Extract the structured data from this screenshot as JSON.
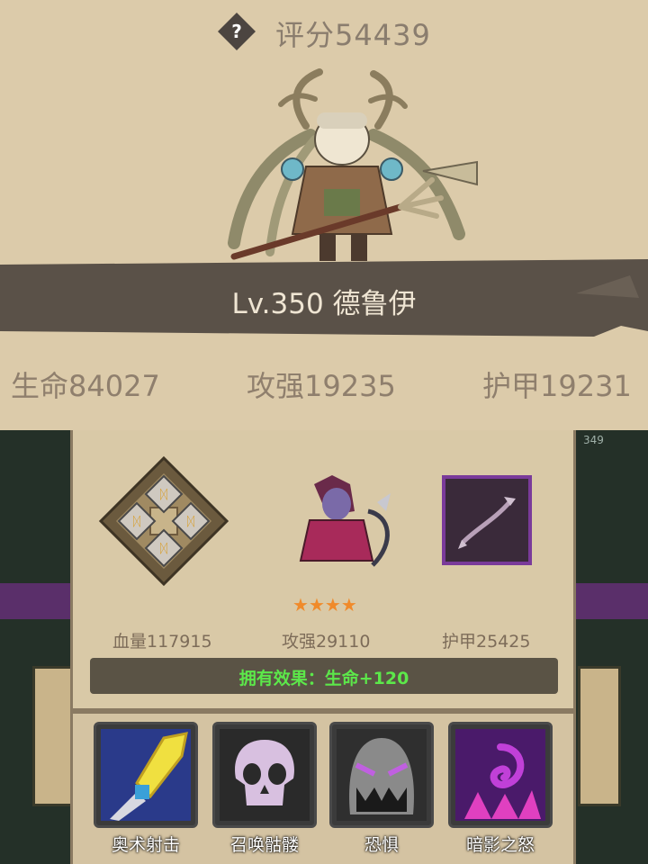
{
  "header": {
    "help_icon": "question-icon",
    "score": "评分54439"
  },
  "hero": {
    "name": "Lv.350 德鲁伊",
    "stats": {
      "hp": "生命84027",
      "attack": "攻强19235",
      "armor": "护甲19231"
    }
  },
  "pet_card": {
    "items": [
      {
        "icon": "rune-cross-icon",
        "label": "血量117915"
      },
      {
        "icon": "dark-elf-archer-icon",
        "label": "攻强29110",
        "stars": 4
      },
      {
        "icon": "purple-bow-icon",
        "label": "护甲25425"
      }
    ],
    "effect": "拥有效果：生命+120"
  },
  "skills": [
    {
      "icon": "arcane-staff-icon",
      "label": "奥术射击"
    },
    {
      "icon": "skull-icon",
      "label": "召唤骷髅"
    },
    {
      "icon": "scream-face-icon",
      "label": "恐惧"
    },
    {
      "icon": "shadow-swirl-icon",
      "label": "暗影之怒"
    }
  ],
  "background": {
    "level_tag": "349"
  },
  "colors": {
    "panel": "#dccbaa",
    "band": "#5a5148",
    "effect_text": "#5ce84a",
    "stars": "#f08a2a"
  }
}
